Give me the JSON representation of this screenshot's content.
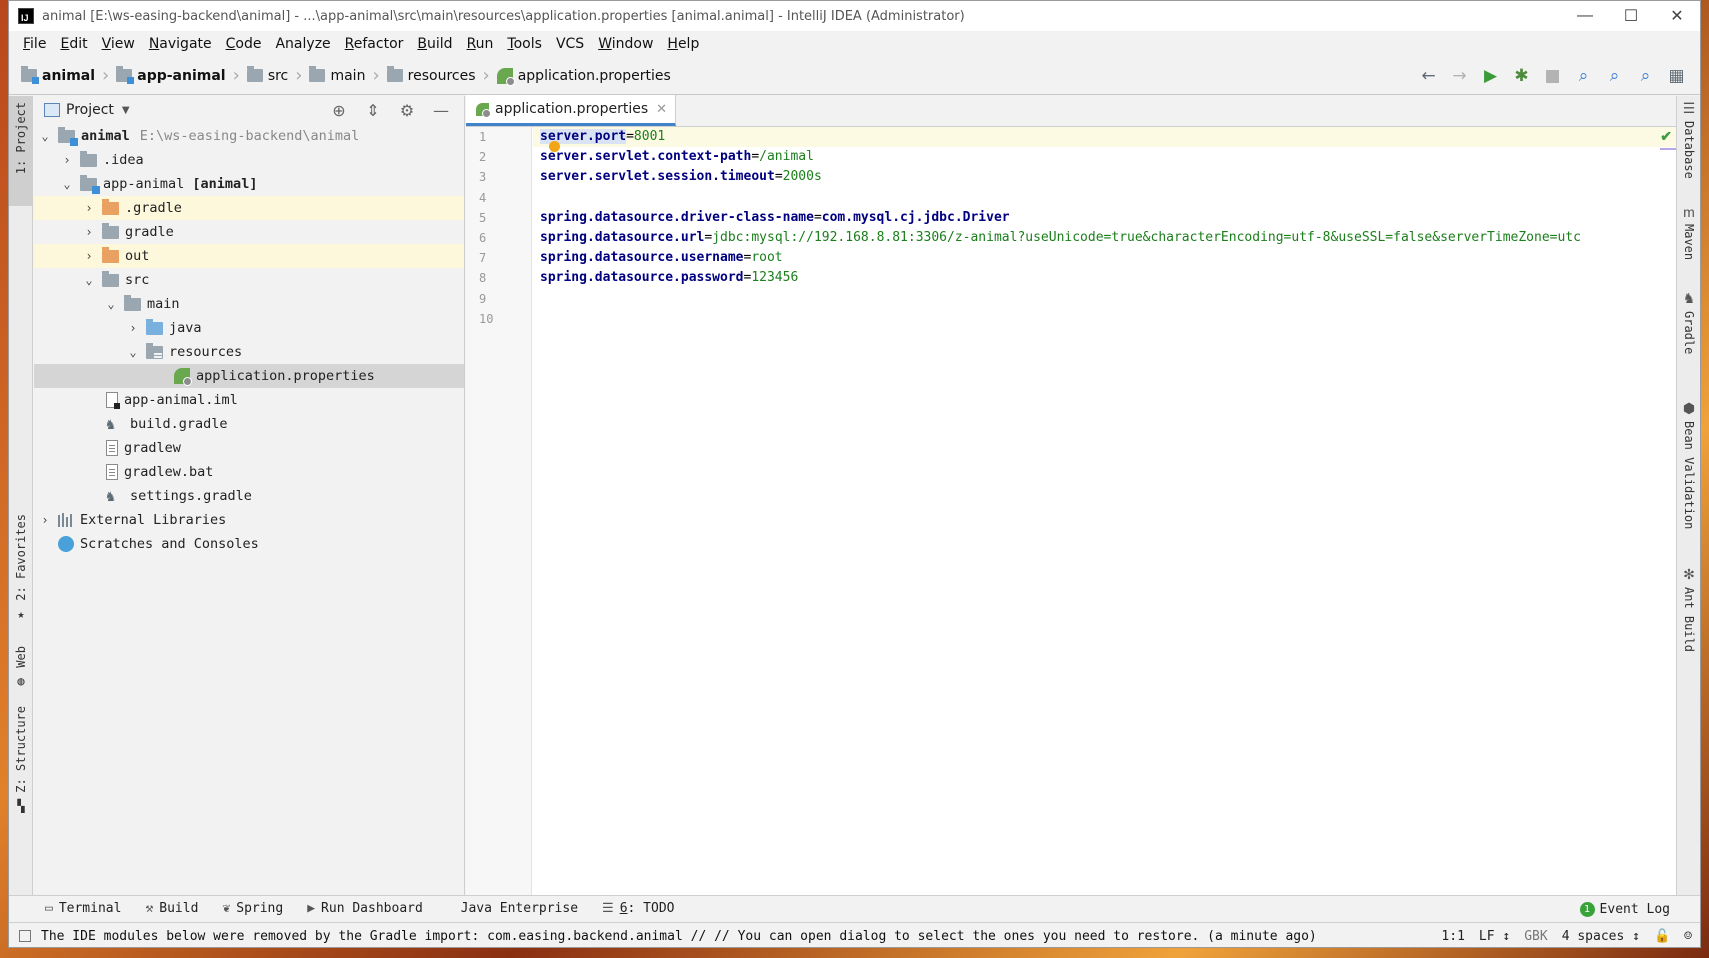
{
  "window": {
    "title": "animal [E:\\ws-easing-backend\\animal] - ...\\app-animal\\src\\main\\resources\\application.properties [animal.animal] - IntelliJ IDEA (Administrator)",
    "app_icon": "IJ",
    "controls": {
      "minimize": "—",
      "maximize": "☐",
      "close": "✕"
    }
  },
  "menu": [
    {
      "mn": "F",
      "rest": "ile"
    },
    {
      "mn": "E",
      "rest": "dit"
    },
    {
      "mn": "V",
      "rest": "iew"
    },
    {
      "mn": "N",
      "rest": "avigate"
    },
    {
      "mn": "C",
      "rest": "ode"
    },
    {
      "mn": "",
      "rest": "Analyze"
    },
    {
      "mn": "R",
      "rest": "efactor"
    },
    {
      "mn": "B",
      "rest": "uild"
    },
    {
      "mn": "R",
      "rest": "un"
    },
    {
      "mn": "T",
      "rest": "ools"
    },
    {
      "mn": "",
      "rest": "VCS"
    },
    {
      "mn": "W",
      "rest": "indow"
    },
    {
      "mn": "H",
      "rest": "elp"
    }
  ],
  "breadcrumbs": [
    "animal",
    "app-animal",
    "src",
    "main",
    "resources",
    "application.properties"
  ],
  "project_panel": {
    "title": "Project",
    "tree": [
      {
        "label": "animal",
        "extra": "E:\\ws-easing-backend\\animal"
      },
      {
        "label": ".idea"
      },
      {
        "label": "app-animal",
        "extra": "[animal]"
      },
      {
        "label": ".gradle"
      },
      {
        "label": "gradle"
      },
      {
        "label": "out"
      },
      {
        "label": "src"
      },
      {
        "label": "main"
      },
      {
        "label": "java"
      },
      {
        "label": "resources"
      },
      {
        "label": "application.properties"
      },
      {
        "label": "app-animal.iml"
      },
      {
        "label": "build.gradle"
      },
      {
        "label": "gradlew"
      },
      {
        "label": "gradlew.bat"
      },
      {
        "label": "settings.gradle"
      },
      {
        "label": "External Libraries"
      },
      {
        "label": "Scratches and Consoles"
      }
    ]
  },
  "left_stripe": {
    "project": "1: Project",
    "favorites": "2: Favorites",
    "web": "Web",
    "structure": "Z: Structure"
  },
  "right_stripe": {
    "database": "Database",
    "maven": "Maven",
    "gradle": "Gradle",
    "bean": "Bean Validation",
    "ant": "Ant Build"
  },
  "editor": {
    "tab": "application.properties",
    "line_numbers": [
      "1",
      "2",
      "3",
      "4",
      "5",
      "6",
      "7",
      "8",
      "9",
      "10"
    ],
    "lines": [
      {
        "key": "server.port",
        "eq": "=",
        "value": "8001"
      },
      {
        "key": "server.servlet.context-path",
        "eq": "=",
        "value": "/animal"
      },
      {
        "key": "server.servlet.session.timeout",
        "eq": "=",
        "value": "2000s"
      },
      {
        "key": "",
        "eq": "",
        "value": ""
      },
      {
        "key": "spring.datasource.driver-class-name",
        "eq": "=",
        "value": "com.mysql.cj.jdbc.Driver"
      },
      {
        "key": "spring.datasource.url",
        "eq": "=",
        "value": "jdbc:mysql://192.168.8.81:3306/z-animal?useUnicode=true&characterEncoding=utf-8&useSSL=false&serverTimeZone=utc"
      },
      {
        "key": "spring.datasource.username",
        "eq": "=",
        "value": "root"
      },
      {
        "key": "spring.datasource.password",
        "eq": "=",
        "value": "123456"
      },
      {
        "key": "",
        "eq": "",
        "value": ""
      },
      {
        "key": "",
        "eq": "",
        "value": ""
      }
    ]
  },
  "bottom_tools": {
    "terminal": "Terminal",
    "build": "Build",
    "spring": "Spring",
    "run_dashboard": "Run Dashboard",
    "java_enterprise": "Java Enterprise",
    "todo_mn": "6",
    "todo": ": TODO",
    "event_count": "1",
    "event_log": "Event Log"
  },
  "status": {
    "message": "The IDE modules below were removed by the Gradle import: com.easing.backend.animal // // You can open dialog to select the ones you need to restore. (a minute ago)",
    "position": "1:1",
    "line_sep": "LF ↕",
    "encoding": "GBK",
    "indent": "4 spaces ↕"
  }
}
